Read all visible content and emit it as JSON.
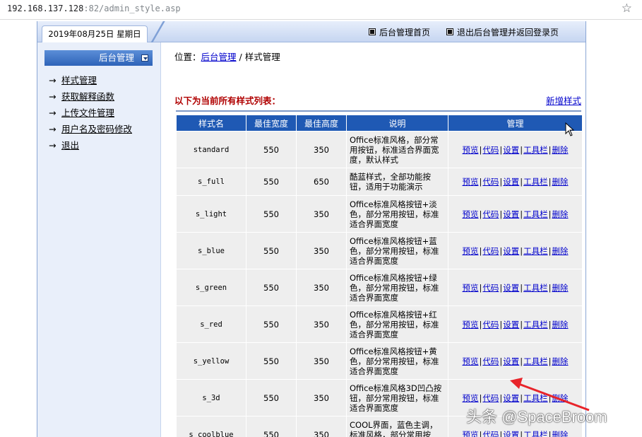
{
  "browser": {
    "url_host": "192.168.137.128",
    "url_rest": ":82/admin_style.asp",
    "star_icon": "star-icon"
  },
  "topbar": {
    "date": "2019年08月25日   星期日",
    "link_home": "后台管理首页",
    "link_logout": "退出后台管理并返回登录页"
  },
  "sidebar": {
    "header": "后台管理",
    "items": [
      {
        "label": "样式管理"
      },
      {
        "label": "获取解释函数"
      },
      {
        "label": "上传文件管理"
      },
      {
        "label": "用户名及密码修改"
      },
      {
        "label": "退出"
      }
    ]
  },
  "main": {
    "breadcrumb_prefix": "位置：",
    "breadcrumb_link": "后台管理",
    "breadcrumb_sep": "/",
    "breadcrumb_current": "样式管理",
    "list_title": "以下为当前所有样式列表：",
    "new_style": "新增样式"
  },
  "table": {
    "headers": [
      "样式名",
      "最佳宽度",
      "最佳高度",
      "说明",
      "管理"
    ],
    "actions": [
      "预览",
      "代码",
      "设置",
      "工具栏",
      "删除"
    ],
    "rows": [
      {
        "name": "standard",
        "width": "550",
        "height": "350",
        "desc": "Office标准风格，部分常用按钮，标准适合界面宽度，默认样式"
      },
      {
        "name": "s_full",
        "width": "550",
        "height": "650",
        "desc": "酷蓝样式，全部功能按钮，适用于功能演示"
      },
      {
        "name": "s_light",
        "width": "550",
        "height": "350",
        "desc": "Office标准风格按钮+淡色，部分常用按钮，标准适合界面宽度"
      },
      {
        "name": "s_blue",
        "width": "550",
        "height": "350",
        "desc": "Office标准风格按钮+蓝色，部分常用按钮，标准适合界面宽度"
      },
      {
        "name": "s_green",
        "width": "550",
        "height": "350",
        "desc": "Office标准风格按钮+绿色，部分常用按钮，标准适合界面宽度"
      },
      {
        "name": "s_red",
        "width": "550",
        "height": "350",
        "desc": "Office标准风格按钮+红色，部分常用按钮，标准适合界面宽度"
      },
      {
        "name": "s_yellow",
        "width": "550",
        "height": "350",
        "desc": "Office标准风格按钮+黄色，部分常用按钮，标准适合界面宽度"
      },
      {
        "name": "s_3d",
        "width": "550",
        "height": "350",
        "desc": "Office标准风格3D凹凸按钮，部分常用按钮，标准适合界面宽度"
      },
      {
        "name": "s_coolblue",
        "width": "550",
        "height": "350",
        "desc": "COOL界面，蓝色主调，标准风格，部分常用按钮，标准适合界面宽度"
      }
    ]
  },
  "overlay": {
    "watermark": "头条 @SpaceBroom"
  },
  "colors": {
    "header_blue": "#1f59b4",
    "link_blue": "#0000cc",
    "title_red": "#b00000",
    "annotation_red": "#e8242a"
  }
}
